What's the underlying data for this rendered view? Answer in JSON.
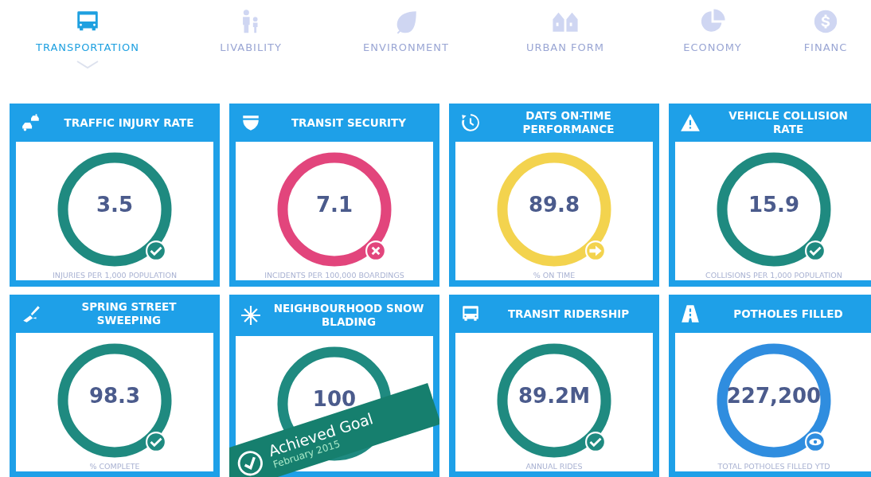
{
  "tabs": [
    {
      "label": "TRANSPORTATION",
      "selected": true
    },
    {
      "label": "LIVABILITY",
      "selected": false
    },
    {
      "label": "ENVIRONMENT",
      "selected": false
    },
    {
      "label": "URBAN FORM",
      "selected": false
    },
    {
      "label": "ECONOMY",
      "selected": false
    },
    {
      "label": "FINANC",
      "selected": false
    }
  ],
  "cards": [
    {
      "title": "TRAFFIC INJURY RATE",
      "value": "3.5",
      "caption": "INJURIES PER 1,000 POPULATION",
      "color": "#1f8a80",
      "kind": "check"
    },
    {
      "title": "TRANSIT SECURITY",
      "value": "7.1",
      "caption": "INCIDENTS PER 100,000 BOARDINGS",
      "color": "#e2457c",
      "kind": "cross"
    },
    {
      "title": "DATS ON-TIME PERFORMANCE",
      "value": "89.8",
      "caption": "% ON TIME",
      "color": "#f3d34e",
      "kind": "arrow"
    },
    {
      "title": "VEHICLE COLLISION RATE",
      "value": "15.9",
      "caption": "COLLISIONS PER 1,000 POPULATION",
      "color": "#1f8a80",
      "kind": "check"
    },
    {
      "title": "SPRING STREET SWEEPING",
      "value": "98.3",
      "caption": "% COMPLETE",
      "color": "#1f8a80",
      "kind": "check"
    },
    {
      "title": "NEIGHBOURHOOD SNOW BLADING",
      "value": "100",
      "color": "#1f8a80",
      "kind": "goal",
      "banner": {
        "title": "Achieved Goal",
        "date": "February 2015"
      }
    },
    {
      "title": "TRANSIT RIDERSHIP",
      "value": "89.2M",
      "caption": "ANNUAL RIDES",
      "color": "#1f8a80",
      "kind": "check"
    },
    {
      "title": "POTHOLES FILLED",
      "value": "227,200",
      "caption": "TOTAL POTHOLES FILLED YTD",
      "color": "#2f8ddf",
      "kind": "eye"
    }
  ]
}
